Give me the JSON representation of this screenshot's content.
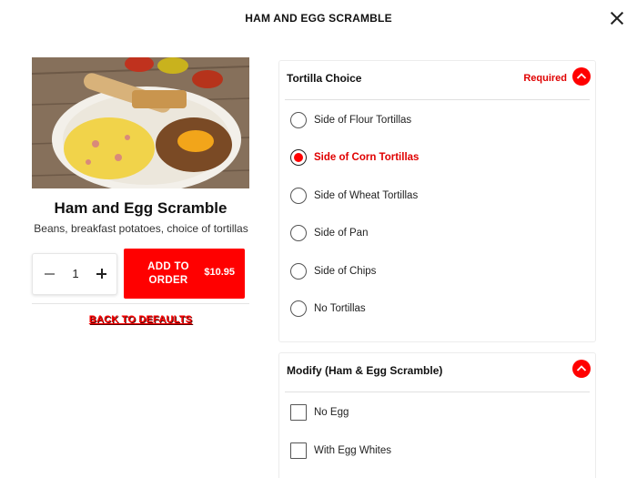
{
  "modal": {
    "title": "HAM AND EGG SCRAMBLE"
  },
  "item": {
    "name": "Ham and Egg Scramble",
    "description": "Beans, breakfast potatoes, choice of tortillas",
    "quantity": "1",
    "add_label": "ADD TO ORDER",
    "price": "$10.95",
    "defaults_link": "BACK TO DEFAULTS"
  },
  "tortilla": {
    "title": "Tortilla Choice",
    "required": "Required",
    "options": [
      {
        "label": "Side of Flour Tortillas",
        "selected": false
      },
      {
        "label": "Side of Corn Tortillas",
        "selected": true
      },
      {
        "label": "Side of Wheat Tortillas",
        "selected": false
      },
      {
        "label": "Side of Pan",
        "selected": false
      },
      {
        "label": "Side of Chips",
        "selected": false
      },
      {
        "label": "No Tortillas",
        "selected": false
      }
    ]
  },
  "modify": {
    "title": "Modify (Ham & Egg Scramble)",
    "options": [
      {
        "label": "No Egg",
        "checked": false
      },
      {
        "label": "With Egg Whites",
        "checked": false
      }
    ]
  },
  "colors": {
    "accent": "#ff0000",
    "text": "#222222"
  },
  "icons": {
    "close": "close-icon",
    "collapse": "chevron-up-icon",
    "minus": "minus-icon",
    "plus": "plus-icon"
  }
}
